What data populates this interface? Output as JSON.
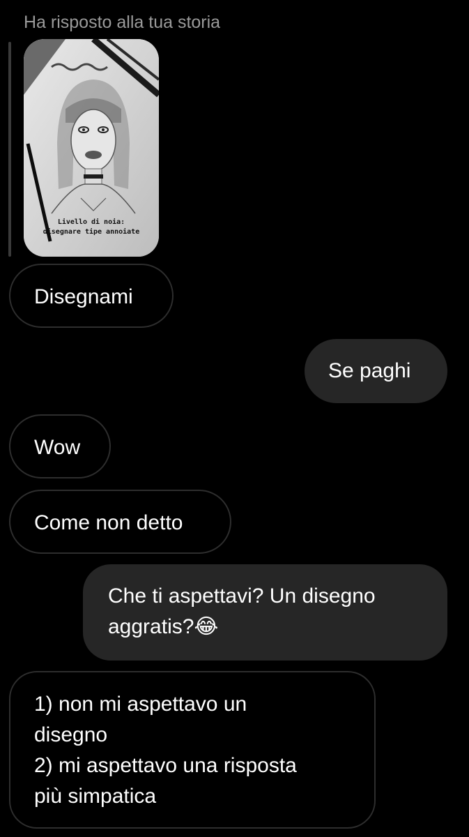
{
  "story": {
    "header": "Ha risposto alla tua storia",
    "caption_line1": "Livello di noia:",
    "caption_line2": "disegnare tipe annoiate"
  },
  "messages": [
    {
      "direction": "received",
      "text": "Disegnami"
    },
    {
      "direction": "sent",
      "text": "Se paghi"
    },
    {
      "direction": "received",
      "text": "Wow"
    },
    {
      "direction": "received",
      "text": "Come non detto"
    },
    {
      "direction": "sent",
      "line1": "Che ti aspettavi? Un disegno",
      "line2": "aggratis?",
      "emoji": "😂"
    },
    {
      "direction": "received",
      "line1": "1) non mi aspettavo un",
      "line2": "disegno",
      "line3": "2) mi aspettavo una risposta",
      "line4": "più simpatica"
    }
  ],
  "colors": {
    "background": "#000000",
    "sent_bubble": "#262626",
    "received_border": "#2e2e2e",
    "header_text": "#9a9a9a"
  }
}
